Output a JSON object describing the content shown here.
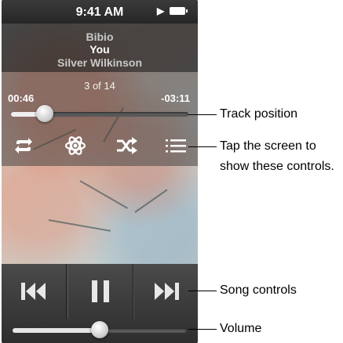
{
  "status_bar": {
    "time": "9:41 AM",
    "play_indicator_icon": "play-icon",
    "battery_icon": "battery-icon"
  },
  "track": {
    "artist": "Bibio",
    "song": "You",
    "album": "Silver Wilkinson"
  },
  "playback": {
    "counter": "3 of 14",
    "elapsed": "00:46",
    "remaining": "-03:11",
    "position_fraction": 0.19
  },
  "overlay_controls": [
    {
      "name": "repeat-icon"
    },
    {
      "name": "genius-icon"
    },
    {
      "name": "shuffle-icon"
    },
    {
      "name": "track-list-icon"
    }
  ],
  "song_controls": [
    {
      "name": "previous-icon"
    },
    {
      "name": "pause-icon"
    },
    {
      "name": "next-icon"
    }
  ],
  "volume": {
    "level_fraction": 0.5
  },
  "callouts": {
    "track_position": "Track position",
    "tap_line1": "Tap the screen to",
    "tap_line2": "show these controls.",
    "song_controls": "Song controls",
    "volume": "Volume"
  }
}
